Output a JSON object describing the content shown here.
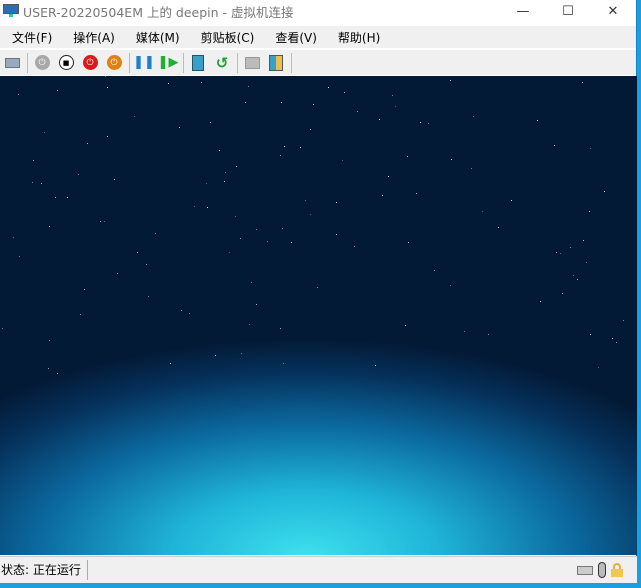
{
  "window": {
    "title": "USER-20220504EM 上的 deepin - 虚拟机连接",
    "controls": {
      "minimize": "—",
      "maximize": "☐",
      "close": "✕"
    }
  },
  "menu": [
    "文件(F)",
    "操作(A)",
    "媒体(M)",
    "剪贴板(C)",
    "查看(V)",
    "帮助(H)"
  ],
  "toolbar": [
    {
      "name": "ctrl-alt-del",
      "icon": "keyboard-icon"
    },
    {
      "name": "start",
      "icon": "power-gray-icon",
      "color": "#a8a8a8"
    },
    {
      "name": "turn-off",
      "icon": "stop-icon",
      "color": "#222222"
    },
    {
      "name": "shut-down",
      "icon": "power-red-icon",
      "color": "#d81b1b"
    },
    {
      "name": "save",
      "icon": "power-orange-icon",
      "color": "#e08010"
    },
    {
      "name": "pause",
      "icon": "pause-icon",
      "color": "#1e7fd0"
    },
    {
      "name": "resume",
      "icon": "resume-icon",
      "color": "#20b030"
    },
    {
      "name": "checkpoint",
      "icon": "checkpoint-icon"
    },
    {
      "name": "revert",
      "icon": "revert-icon",
      "color": "#20a030"
    },
    {
      "name": "enhanced-session",
      "icon": "monitor-icon"
    },
    {
      "name": "share",
      "icon": "share-icon"
    }
  ],
  "status": {
    "text": "状态: 正在运行"
  }
}
